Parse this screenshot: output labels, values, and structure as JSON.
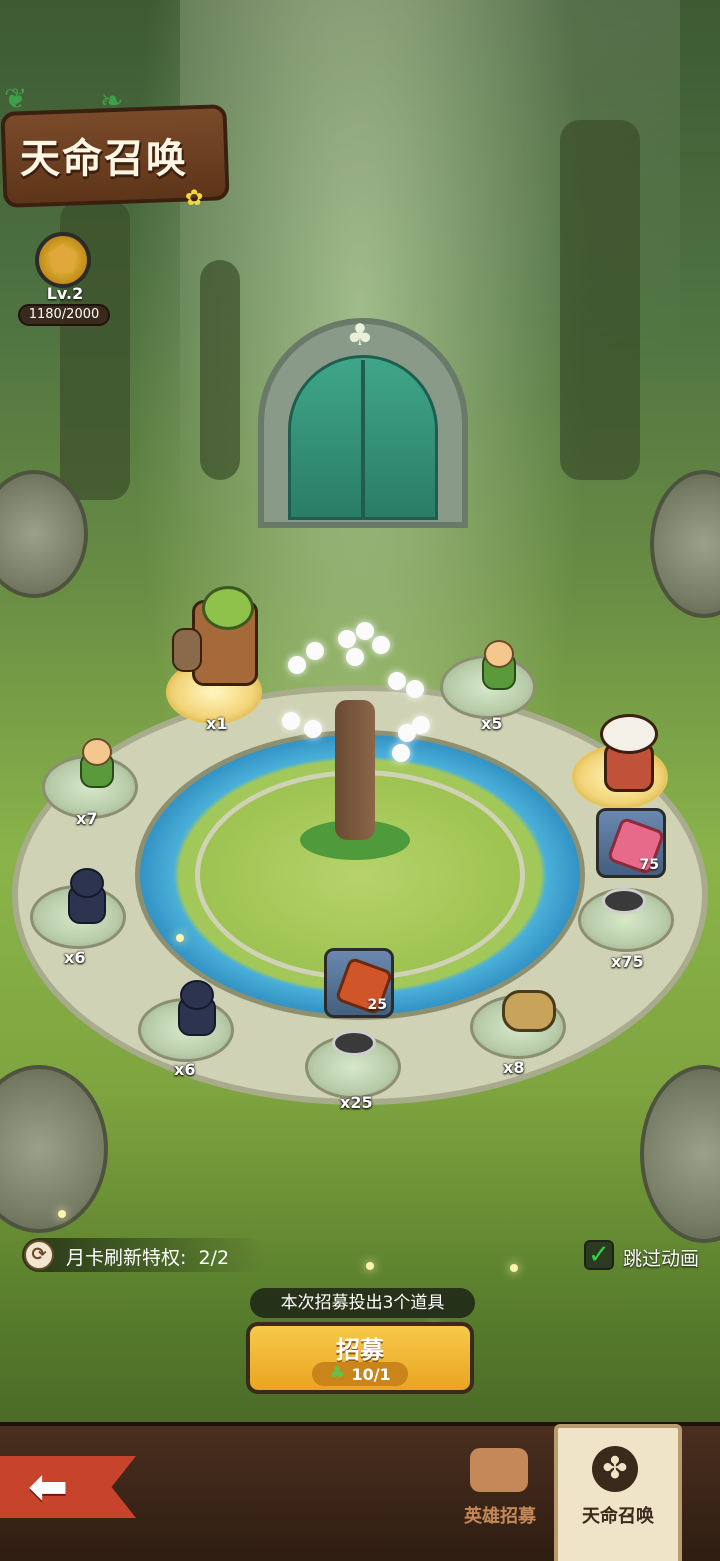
{
  "header": {
    "title": "天命召唤"
  },
  "level": {
    "label": "Lv.2",
    "exp": "1180/2000",
    "progress": 0.59
  },
  "slots": [
    {
      "name": "tree-guardian",
      "count": "x1"
    },
    {
      "name": "swordsman",
      "count": "x5"
    },
    {
      "name": "cowboy-gunner",
      "count": ""
    },
    {
      "name": "red-gem-item",
      "count": "x75",
      "item_count": "75"
    },
    {
      "name": "golden-bug",
      "count": "x8"
    },
    {
      "name": "red-scroll-item",
      "count": "x25",
      "item_count": "25"
    },
    {
      "name": "ninja",
      "count": "x6"
    },
    {
      "name": "ninja",
      "count": "x6"
    },
    {
      "name": "swordsman",
      "count": "x7"
    }
  ],
  "controls": {
    "refresh_label": "月卡刷新特权:",
    "refresh_value": "2/2",
    "skip_animation": "跳过动画",
    "notice": "本次招募投出3个道具",
    "recruit_label": "招募",
    "recruit_cost": "10/1"
  },
  "nav": {
    "tab_hero": "英雄招募",
    "tab_summon": "天命召唤"
  },
  "colors": {
    "accent": "#f7c94a",
    "back_button": "#c8432b",
    "check": "#35d04a"
  }
}
